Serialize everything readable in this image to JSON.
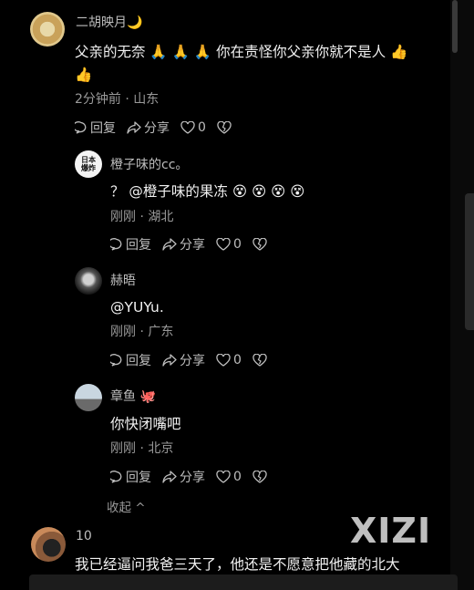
{
  "comments": [
    {
      "name": "二胡映月🌙",
      "text_line1": "父亲的无奈 🙏 🙏 🙏 你在责怪你父亲你就不是人 👍",
      "text_line2": "👍",
      "meta": "2分钟前 · 山东",
      "reply": "回复",
      "share": "分享",
      "likes": "0"
    },
    {
      "name": "橙子味的cc。",
      "avatar_text": "日本\n爆炸",
      "text_line1": "？ @橙子味的果冻  😵 😵 😵 😵",
      "meta": "刚刚 · 湖北",
      "reply": "回复",
      "share": "分享",
      "likes": "0"
    },
    {
      "name": "赫晤",
      "text_line1": "@YUYu.",
      "meta": "刚刚 · 广东",
      "reply": "回复",
      "share": "分享",
      "likes": "0"
    },
    {
      "name": "章鱼 🐙",
      "text_line1": "你快闭嘴吧",
      "meta": "刚刚 · 北京",
      "reply": "回复",
      "share": "分享",
      "likes": "0"
    },
    {
      "name": "10",
      "text_line1": "我已经逼问我爸三天了，他还是不愿意把他藏的北大"
    }
  ],
  "collapse_label": "收起 ^",
  "watermark": "XIZI",
  "colors": {
    "background": "#000000",
    "text": "#f2f2f2",
    "meta": "#9a9a9a"
  }
}
